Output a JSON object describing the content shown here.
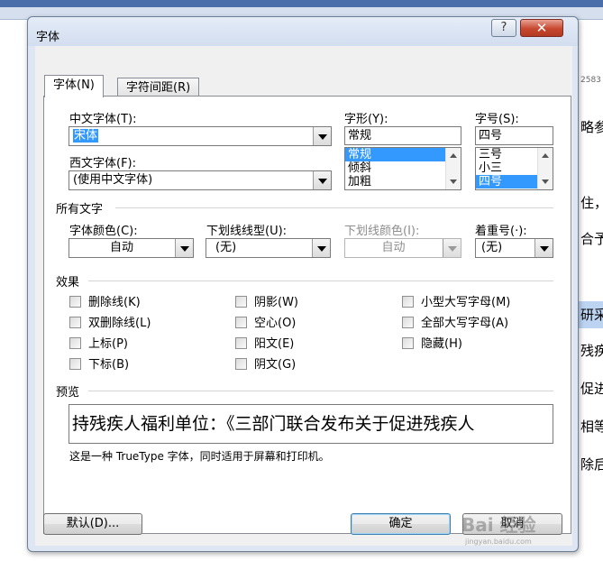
{
  "background": {
    "margin_texts": [
      "2583",
      "略参",
      "住，",
      "合予",
      "研采",
      "残疾",
      "促进",
      "相等",
      "除后"
    ]
  },
  "dialog": {
    "title": "字体",
    "help_label": "?",
    "close_label": "✕"
  },
  "tabs": [
    {
      "label": "字体(N)",
      "active": true
    },
    {
      "label": "字符间距(R)",
      "active": false
    }
  ],
  "font": {
    "chinese_font_label": "中文字体(T):",
    "chinese_font_value": "宋体",
    "western_font_label": "西文字体(F):",
    "western_font_value": "(使用中文字体)",
    "style_label": "字形(Y):",
    "style_value": "常规",
    "style_options": [
      "常规",
      "倾斜",
      "加粗"
    ],
    "size_label": "字号(S):",
    "size_value": "四号",
    "size_options": [
      "三号",
      "小三",
      "四号"
    ]
  },
  "all_text": {
    "section_label": "所有文字",
    "font_color_label": "字体颜色(C):",
    "font_color_value": "自动",
    "underline_style_label": "下划线线型(U):",
    "underline_style_value": "(无)",
    "underline_color_label": "下划线颜色(I):",
    "underline_color_value": "自动",
    "emphasis_label": "着重号(·):",
    "emphasis_value": "(无)"
  },
  "effects": {
    "section_label": "效果",
    "items": [
      "删除线(K)",
      "双删除线(L)",
      "上标(P)",
      "下标(B)",
      "阴影(W)",
      "空心(O)",
      "阳文(E)",
      "阴文(G)",
      "小型大写字母(M)",
      "全部大写字母(A)",
      "隐藏(H)"
    ]
  },
  "preview": {
    "section_label": "预览",
    "sample_text": "持残疾人福利单位：《三部门联合发布关于促进残疾人",
    "note": "这是一种 TrueType 字体，同时适用于屏幕和打印机。"
  },
  "buttons": {
    "default_label": "默认(D)...",
    "ok_label": "确定",
    "cancel_label": "取消"
  },
  "watermark": {
    "text": "Bai 经验",
    "sub": "jingyan.baidu.com"
  }
}
